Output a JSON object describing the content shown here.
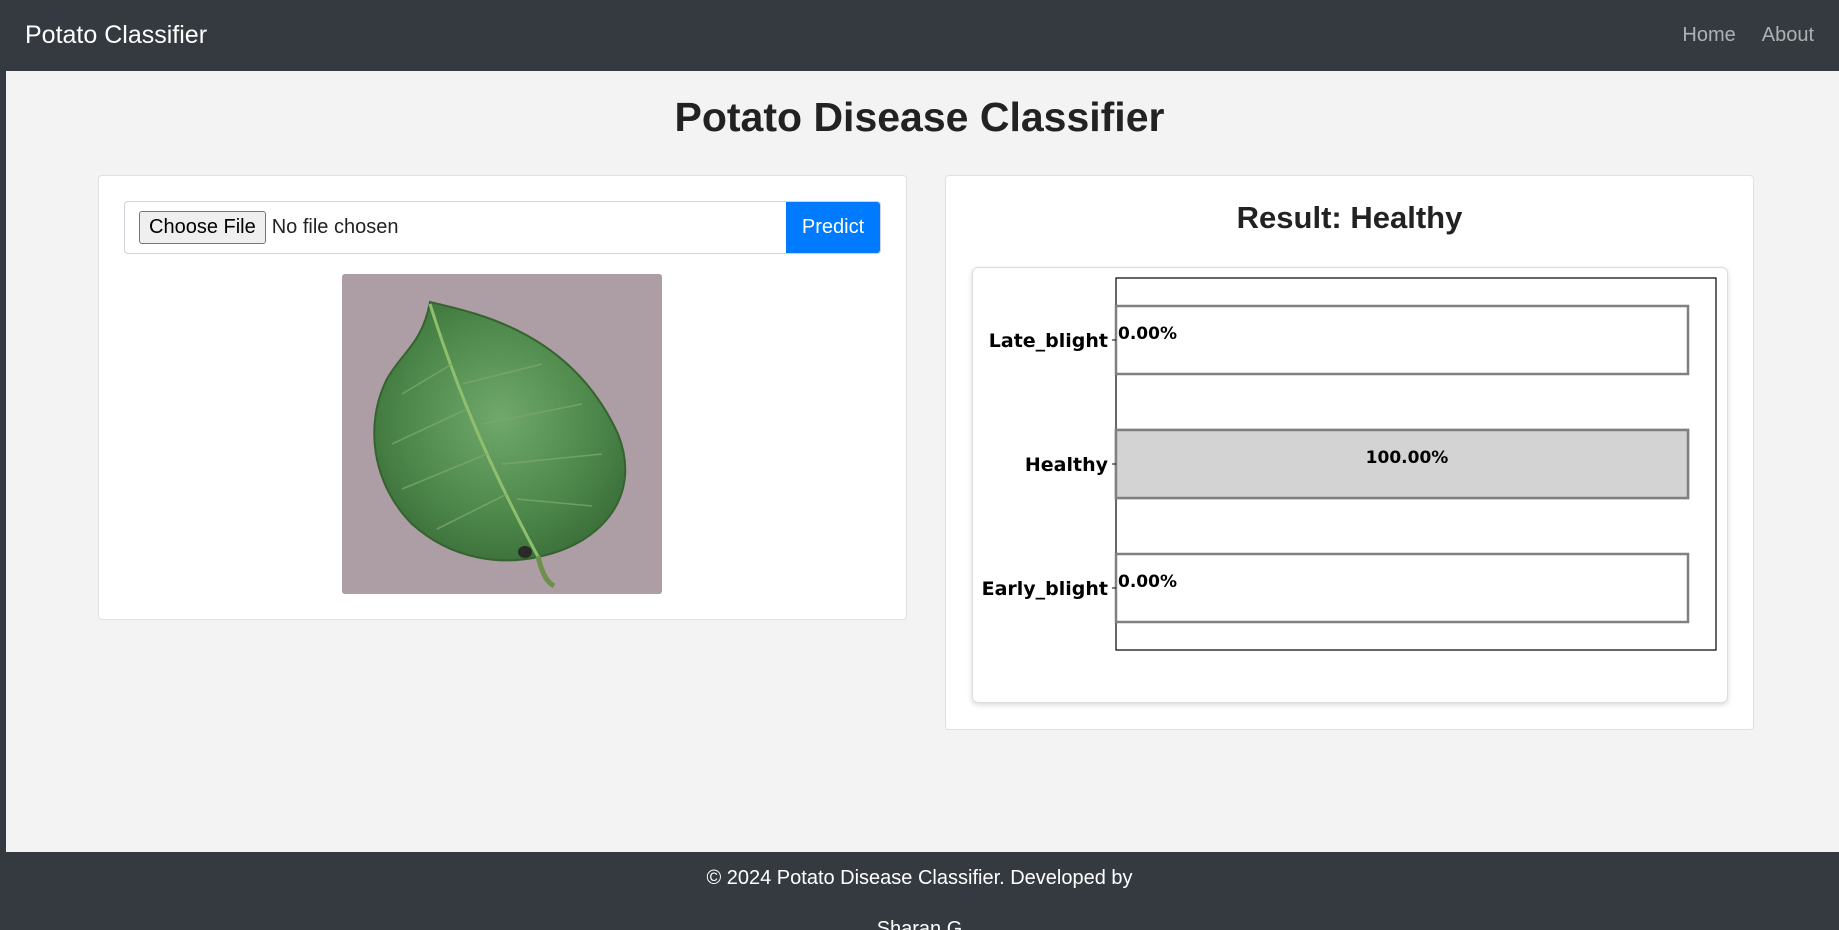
{
  "navbar": {
    "brand": "Potato Classifier",
    "links": [
      "Home",
      "About"
    ]
  },
  "page_title": "Potato Disease Classifier",
  "upload": {
    "choose_label": "Choose File",
    "file_status": "No file chosen",
    "predict_label": "Predict"
  },
  "image": {
    "alt": "potato leaf"
  },
  "result": {
    "title": "Result: Healthy"
  },
  "chart_data": {
    "type": "bar",
    "orientation": "horizontal",
    "categories": [
      "Late_blight",
      "Healthy",
      "Early_blight"
    ],
    "values": [
      0.0,
      100.0,
      0.0
    ],
    "data_labels": [
      "0.00%",
      "100.00%",
      "0.00%"
    ],
    "xlim": [
      0,
      100
    ],
    "grid": false
  },
  "footer": {
    "line1": "© 2024 Potato Disease Classifier. Developed by",
    "line2": "Sharan G"
  },
  "colors": {
    "navbar": "#343a40",
    "accent": "#007bff",
    "bar_fill": "#d3d3d3",
    "bar_stroke": "#808080"
  }
}
